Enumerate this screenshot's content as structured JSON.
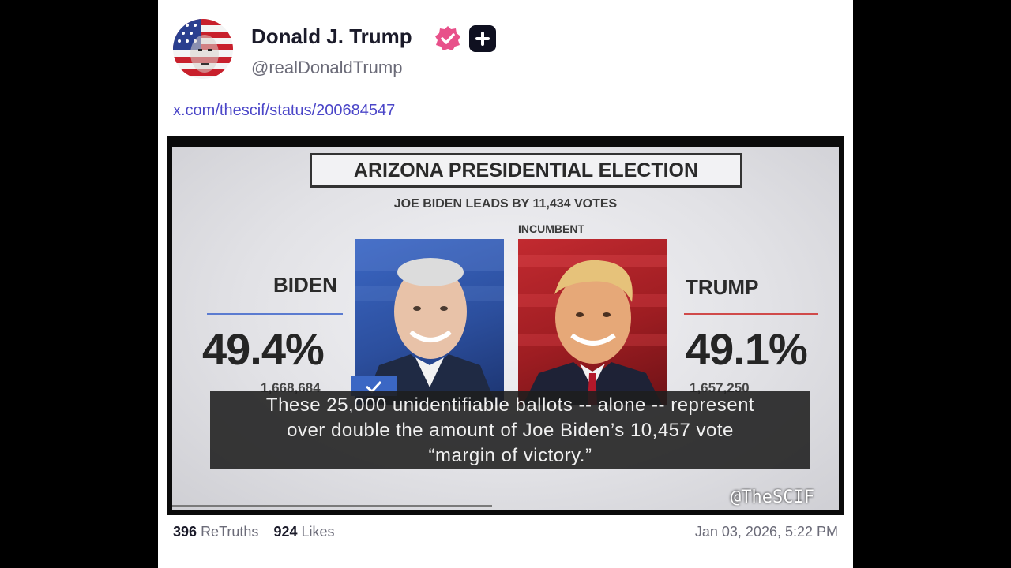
{
  "post": {
    "author_name": "Donald J. Trump",
    "handle": "@realDonaldTrump",
    "link_text": "x.com/thescif/status/200684547",
    "badge_color": "#e8508a",
    "link_color": "#4b46c8",
    "retruths_count": "396",
    "retruths_label": "ReTruths",
    "likes_count": "924",
    "likes_label": "Likes",
    "timestamp": "Jan 03, 2026, 5:22 PM"
  },
  "video": {
    "title": "ARIZONA PRESIDENTIAL ELECTION",
    "subtitle": "JOE BIDEN LEADS BY 11,434 VOTES",
    "incumbent_label": "INCUMBENT",
    "left_candidate": {
      "name": "BIDEN",
      "percent": "49.4%",
      "votes": "1,668,684",
      "color": "#3b67c4"
    },
    "right_candidate": {
      "name": "TRUMP",
      "percent": "49.1%",
      "votes": "1,657,250",
      "color": "#c22a30"
    },
    "caption_lines": [
      "These 25,000 unidentifiable ballots -- alone -- represent",
      "over double the amount of Joe Biden’s 10,457 vote",
      "“margin of victory.”"
    ],
    "watermark": "@TheSCIF",
    "progress": 0.48
  }
}
